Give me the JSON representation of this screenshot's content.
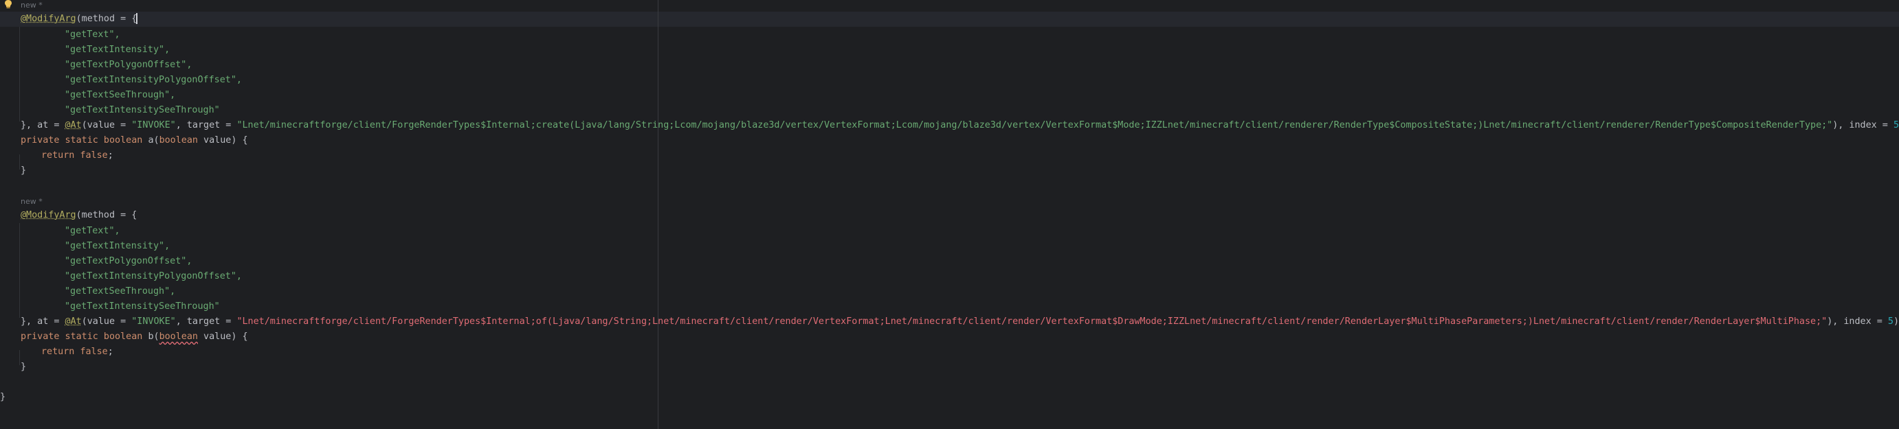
{
  "editor": {
    "inlay_hint": "new *",
    "blocks": [
      {
        "annotation": "@ModifyArg",
        "method_open": "(method = {",
        "methods": [
          "\"getText\",",
          "\"getTextIntensity\",",
          "\"getTextPolygonOffset\",",
          "\"getTextIntensityPolygonOffset\",",
          "\"getTextSeeThrough\",",
          "\"getTextIntensitySeeThrough\""
        ],
        "at_prefix": "}, at = ",
        "at_annotation": "@At",
        "value_part": "(value = ",
        "value_string": "\"INVOKE\"",
        "target_part": ", target = ",
        "target_string": "\"Lnet/minecraftforge/client/ForgeRenderTypes$Internal;create(Ljava/lang/String;Lcom/mojang/blaze3d/vertex/VertexFormat;Lcom/mojang/blaze3d/vertex/VertexFormat$Mode;IZZLnet/minecraft/client/renderer/RenderType$CompositeState;)Lnet/minecraft/client/renderer/RenderType$CompositeRenderType;\"",
        "index_part": "), index = ",
        "index_value": "5",
        "index_close": ")",
        "signature_kw": "private static boolean ",
        "method_name": "a",
        "param_open": "(",
        "param_type": "boolean",
        "param_rest": " value) {",
        "return_kw": "return ",
        "return_val": "false",
        "return_end": ";",
        "close_brace": "}"
      },
      {
        "annotation": "@ModifyArg",
        "method_open": "(method = {",
        "methods": [
          "\"getText\",",
          "\"getTextIntensity\",",
          "\"getTextPolygonOffset\",",
          "\"getTextIntensityPolygonOffset\",",
          "\"getTextSeeThrough\",",
          "\"getTextIntensitySeeThrough\""
        ],
        "at_prefix": "}, at = ",
        "at_annotation": "@At",
        "value_part": "(value = ",
        "value_string": "\"INVOKE\"",
        "target_part": ", target = ",
        "target_string": "\"Lnet/minecraftforge/client/ForgeRenderTypes$Internal;of(Ljava/lang/String;Lnet/minecraft/client/render/VertexFormat;Lnet/minecraft/client/render/VertexFormat$DrawMode;IZZLnet/minecraft/client/render/RenderLayer$MultiPhaseParameters;)Lnet/minecraft/client/render/RenderLayer$MultiPhase;\"",
        "index_part": "), index = ",
        "index_value": "5",
        "index_close": ")",
        "signature_kw": "private static boolean ",
        "method_name": "b",
        "param_open": "(",
        "param_type": "boolean",
        "param_rest": " value) {",
        "return_kw": "return ",
        "return_val": "false",
        "return_end": ";",
        "close_brace": "}"
      }
    ],
    "final_brace": "}"
  },
  "colors": {
    "background": "#1e1f22",
    "annotation": "#b3ae60",
    "keyword": "#cf8e6d",
    "string": "#6aab73",
    "string_error": "#e06c75",
    "number": "#2aacb8",
    "text": "#bcbec4"
  },
  "icons": {
    "gutter": "lightbulb-icon"
  }
}
